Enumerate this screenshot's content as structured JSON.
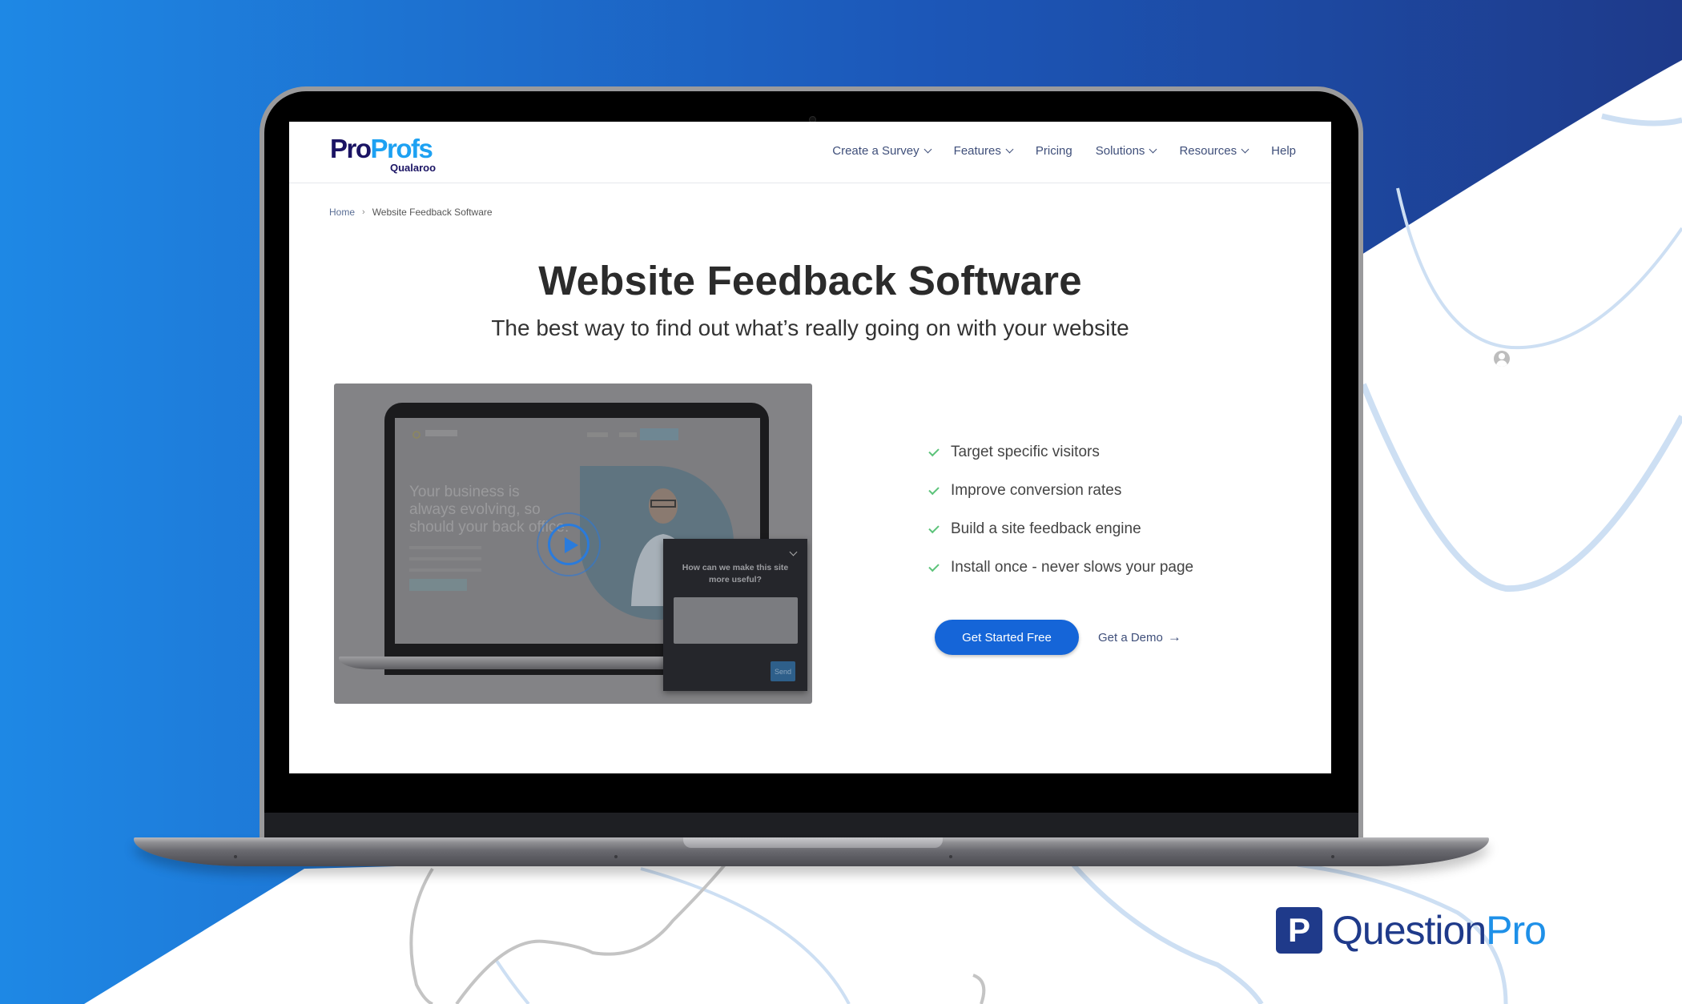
{
  "site": {
    "logo": {
      "main_dark": "Pro",
      "main_light": "Profs",
      "sub": "Qualaroo"
    },
    "nav": [
      {
        "label": "Create a Survey",
        "has_dropdown": true
      },
      {
        "label": "Features",
        "has_dropdown": true
      },
      {
        "label": "Pricing",
        "has_dropdown": false
      },
      {
        "label": "Solutions",
        "has_dropdown": true
      },
      {
        "label": "Resources",
        "has_dropdown": true
      },
      {
        "label": "Help",
        "has_dropdown": false
      }
    ],
    "breadcrumb": {
      "home": "Home",
      "separator": "›",
      "current": "Website Feedback Software"
    },
    "hero": {
      "title": "Website Feedback Software",
      "subtitle": "The best way to find out what’s really going on with your website"
    },
    "video": {
      "hero_text": "Your business is always evolving, so should your back office.",
      "play_icon": "play-icon",
      "popup": {
        "question": "How can we make this site more useful?",
        "input_placeholder": "",
        "send_label": "Send"
      }
    },
    "features": [
      "Target specific visitors",
      "Improve conversion rates",
      "Build a site feedback engine",
      "Install once - never slows your page"
    ],
    "cta": {
      "primary": "Get Started Free",
      "secondary": "Get a Demo",
      "secondary_icon": "→"
    }
  },
  "brand": {
    "mark_letter": "P",
    "name_dark": "Question",
    "name_light": "Pro"
  },
  "colors": {
    "bg_blue_left": "#1e88e5",
    "bg_blue_right": "#1e3a8a",
    "primary_button": "#1565d8",
    "check_green": "#5cc37a",
    "nav_text": "#3f4f7a",
    "logo_dark": "#1b1464",
    "logo_light": "#1da1f2",
    "curve_light_blue": "#cddff3",
    "curve_gray": "#c4c4c4"
  }
}
